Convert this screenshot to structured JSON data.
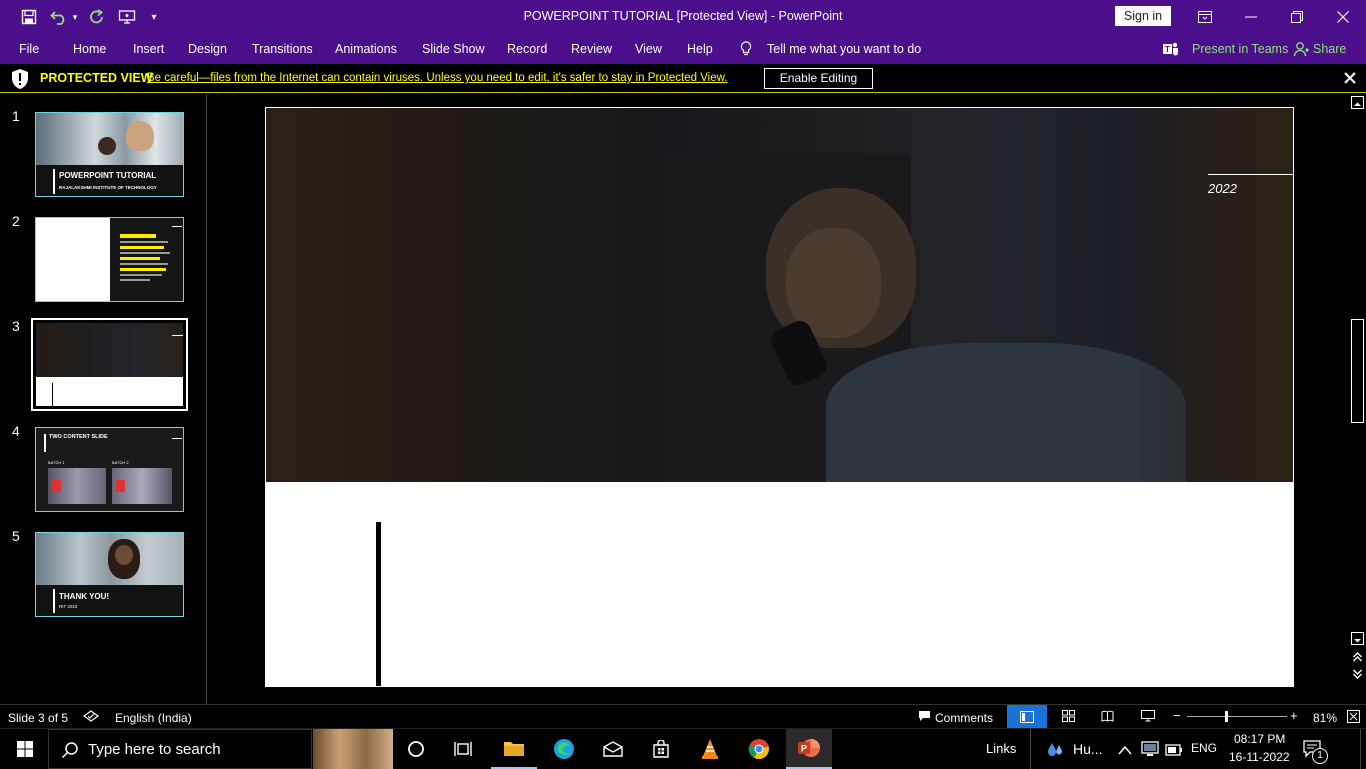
{
  "window": {
    "title": "POWERPOINT TUTORIAL [Protected View]  -  PowerPoint",
    "sign_in": "Sign in"
  },
  "quick_access": [
    "save-icon",
    "undo-icon",
    "redo-icon",
    "present-icon",
    "customize-icon"
  ],
  "ribbon": {
    "tabs": [
      "File",
      "Home",
      "Insert",
      "Design",
      "Transitions",
      "Animations",
      "Slide Show",
      "Record",
      "Review",
      "View",
      "Help"
    ],
    "tell_me": "Tell me what you want to do",
    "present_in_teams": "Present in Teams",
    "share": "Share"
  },
  "protected_view": {
    "label": "PROTECTED VIEW",
    "message": "Be careful—files from the Internet can contain viruses. Unless you need to edit, it's safer to stay in Protected View.",
    "enable_button": "Enable Editing"
  },
  "thumbnails": [
    {
      "number": "1",
      "title": "POWERPOINT TUTORIAL",
      "subtitle": "RAJALAKSHMI INSTITUTE OF TECHNOLOGY"
    },
    {
      "number": "2"
    },
    {
      "number": "3"
    },
    {
      "number": "4",
      "title": "TWO CONTENT SLIDE",
      "label_a": "BATCH 1",
      "label_b": "BATCH 2"
    },
    {
      "number": "5",
      "title": "THANK YOU!",
      "subtitle": "RIT 2022"
    }
  ],
  "slide": {
    "year": "2022"
  },
  "status": {
    "slide_info": "Slide 3 of 5",
    "language": "English (India)",
    "comments": "Comments",
    "zoom": "81%"
  },
  "taskbar": {
    "search_placeholder": "Type here to search",
    "links": "Links",
    "weather": "Hu...",
    "lang": "ENG",
    "time": "08:17 PM",
    "date": "16-11-2022",
    "notifications": "1"
  },
  "colors": {
    "title_bar": "#4b0f8c",
    "protected_yellow": "#ffff00",
    "thumb_border": "#6fd3e0"
  }
}
